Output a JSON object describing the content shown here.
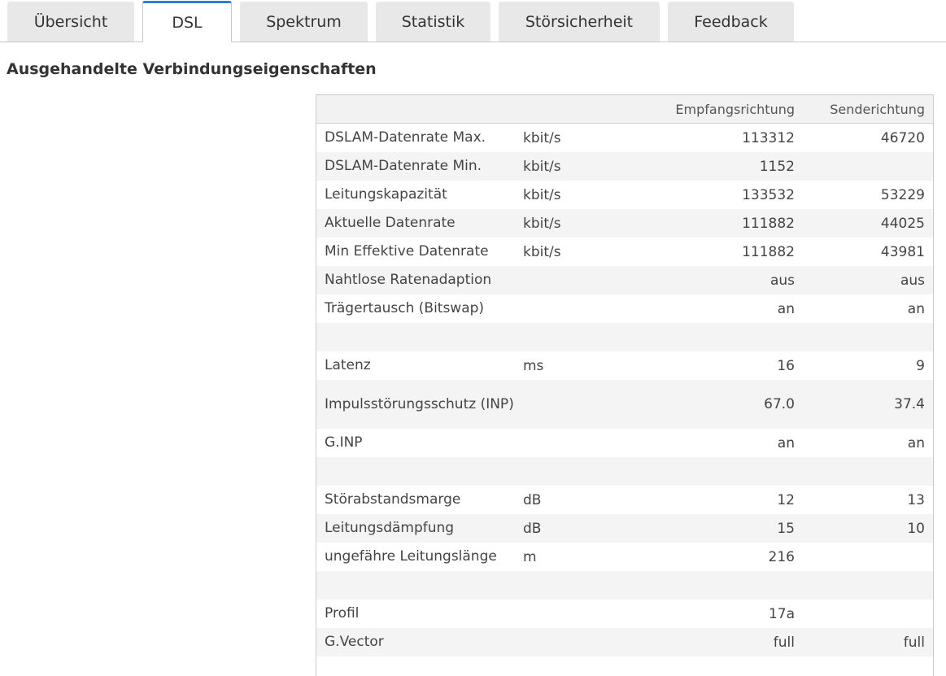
{
  "tabs": [
    {
      "label": "Übersicht",
      "active": false
    },
    {
      "label": "DSL",
      "active": true
    },
    {
      "label": "Spektrum",
      "active": false
    },
    {
      "label": "Statistik",
      "active": false
    },
    {
      "label": "Störsicherheit",
      "active": false
    },
    {
      "label": "Feedback",
      "active": false
    }
  ],
  "section_title": "Ausgehandelte Verbindungseigenschaften",
  "table": {
    "headers": {
      "label": "",
      "unit": "",
      "rx": "Empfangsrichtung",
      "tx": "Senderichtung"
    },
    "rows": [
      {
        "label": "DSLAM-Datenrate Max.",
        "unit": "kbit/s",
        "rx": "113312",
        "tx": "46720"
      },
      {
        "label": "DSLAM-Datenrate Min.",
        "unit": "kbit/s",
        "rx": "1152",
        "tx": ""
      },
      {
        "label": "Leitungskapazität",
        "unit": "kbit/s",
        "rx": "133532",
        "tx": "53229"
      },
      {
        "label": "Aktuelle Datenrate",
        "unit": "kbit/s",
        "rx": "111882",
        "tx": "44025"
      },
      {
        "label": "Min Effektive Datenrate",
        "unit": "kbit/s",
        "rx": "111882",
        "tx": "43981"
      },
      {
        "label": "Nahtlose Ratenadaption",
        "unit": "",
        "rx": "aus",
        "tx": "aus"
      },
      {
        "label": "Trägertausch (Bitswap)",
        "unit": "",
        "rx": "an",
        "tx": "an"
      },
      {
        "label": "",
        "unit": "",
        "rx": "",
        "tx": ""
      },
      {
        "label": "Latenz",
        "unit": "ms",
        "rx": "16",
        "tx": "9"
      },
      {
        "label": "Impulsstörungsschutz (INP)",
        "unit": "",
        "rx": "67.0",
        "tx": "37.4"
      },
      {
        "label": "G.INP",
        "unit": "",
        "rx": "an",
        "tx": "an"
      },
      {
        "label": "",
        "unit": "",
        "rx": "",
        "tx": ""
      },
      {
        "label": "Störabstandsmarge",
        "unit": "dB",
        "rx": "12",
        "tx": "13"
      },
      {
        "label": "Leitungsdämpfung",
        "unit": "dB",
        "rx": "15",
        "tx": "10"
      },
      {
        "label": "ungefähre Leitungslänge",
        "unit": "m",
        "rx": "216",
        "tx": ""
      },
      {
        "label": "",
        "unit": "",
        "rx": "",
        "tx": ""
      },
      {
        "label": "Profil",
        "unit": "",
        "rx": "17a",
        "tx": ""
      },
      {
        "label": "G.Vector",
        "unit": "",
        "rx": "full",
        "tx": "full"
      }
    ]
  }
}
